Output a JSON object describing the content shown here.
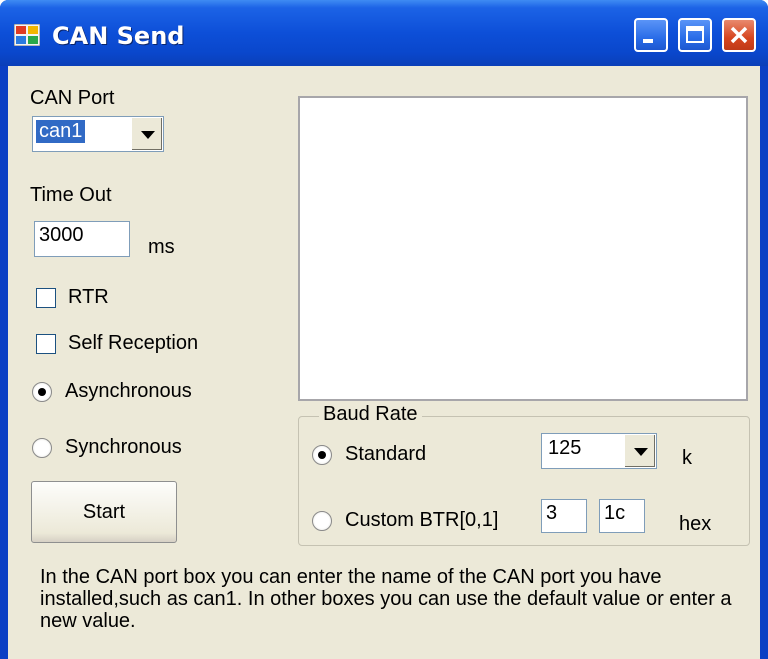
{
  "window": {
    "title": "CAN Send"
  },
  "port": {
    "label": "CAN Port",
    "value": "can1"
  },
  "timeout": {
    "label": "Time Out",
    "value": "3000",
    "unit": "ms"
  },
  "options": {
    "rtr": {
      "label": "RTR",
      "checked": false
    },
    "self_reception": {
      "label": "Self Reception",
      "checked": false
    },
    "asynchronous": {
      "label": "Asynchronous",
      "selected": true
    },
    "synchronous": {
      "label": "Synchronous",
      "selected": false
    }
  },
  "start_button": "Start",
  "baud": {
    "title": "Baud Rate",
    "standard_label": "Standard",
    "standard_value": "125",
    "standard_unit": "k",
    "custom_label": "Custom BTR[0,1]",
    "btr0": "3",
    "btr1": "1c",
    "custom_unit": "hex"
  },
  "info_text": "In the CAN port box you can enter the name of the CAN port you have installed,such as can1. In other boxes you can use the default value or enter a new value.",
  "icons": [
    "app-icon",
    "minimize-icon",
    "maximize-icon",
    "close-icon",
    "dropdown-arrow-icon"
  ]
}
